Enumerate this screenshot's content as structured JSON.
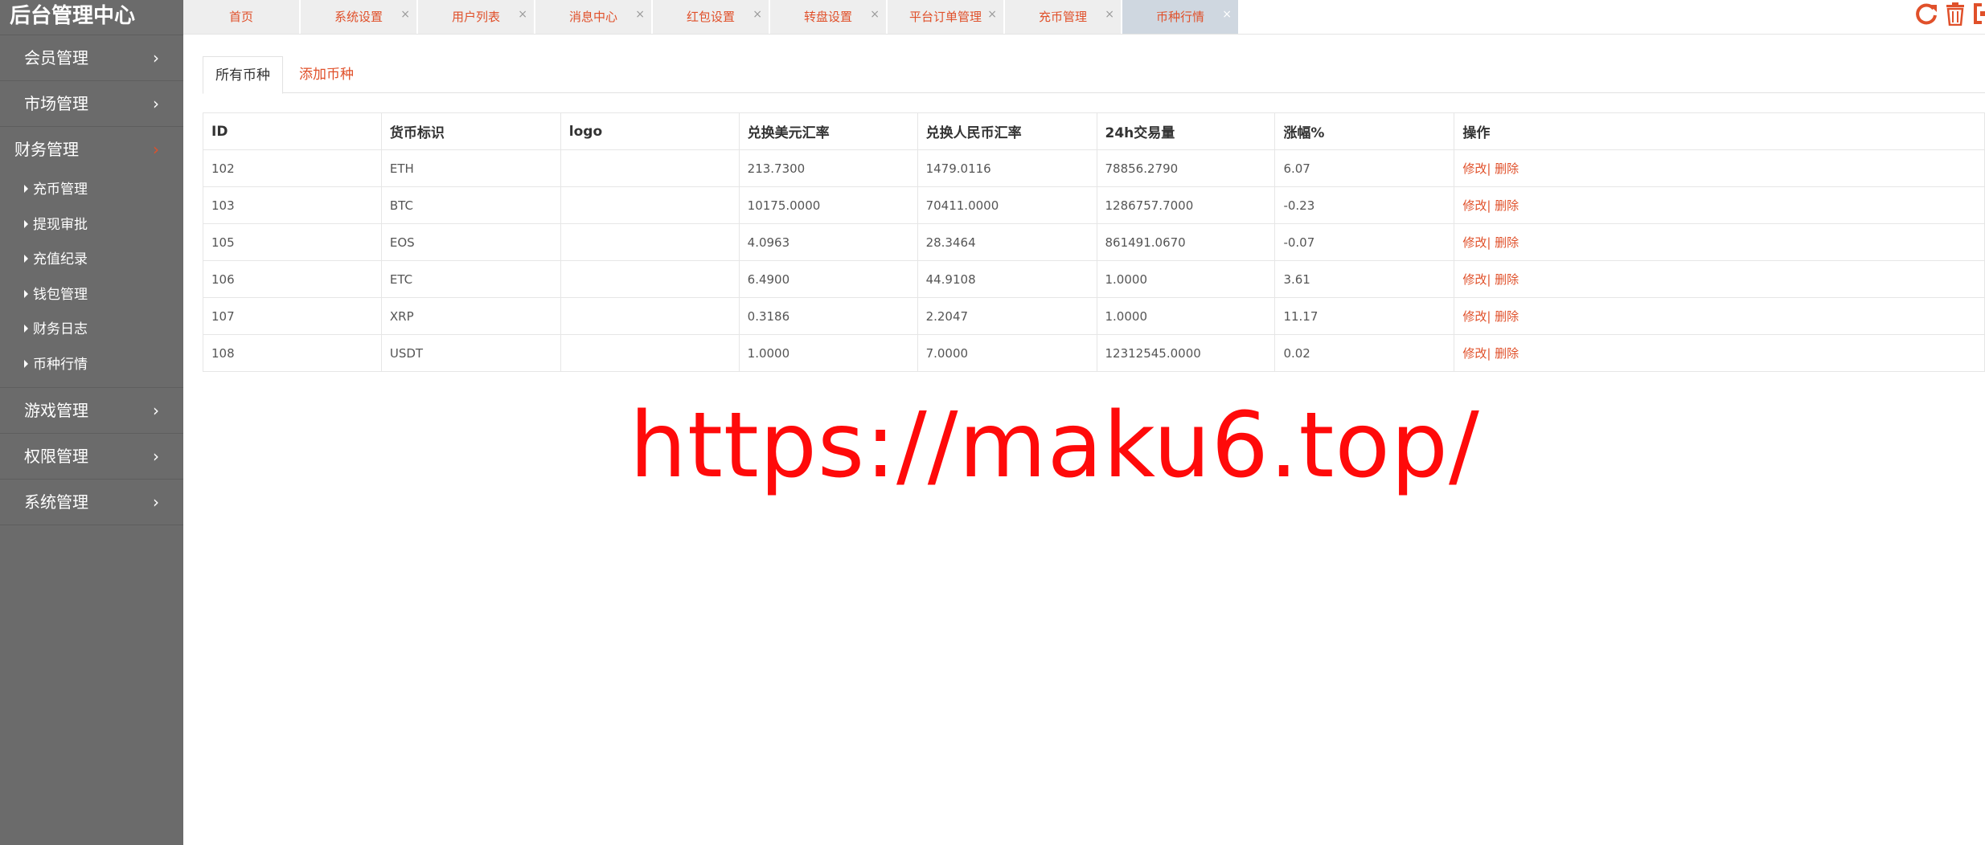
{
  "sidebar": {
    "brand": "后台管理中心",
    "items": [
      {
        "label": "会员管理"
      },
      {
        "label": "市场管理"
      },
      {
        "label": "财务管理"
      },
      {
        "label": "游戏管理"
      },
      {
        "label": "权限管理"
      },
      {
        "label": "系统管理"
      }
    ],
    "finance_sub": [
      {
        "label": "充币管理"
      },
      {
        "label": "提现审批"
      },
      {
        "label": "充值纪录"
      },
      {
        "label": "钱包管理"
      },
      {
        "label": "财务日志"
      },
      {
        "label": "币种行情"
      }
    ],
    "chevron": "›"
  },
  "tabs": [
    {
      "label": "首页"
    },
    {
      "label": "系统设置"
    },
    {
      "label": "用户列表"
    },
    {
      "label": "消息中心"
    },
    {
      "label": "红包设置"
    },
    {
      "label": "转盘设置"
    },
    {
      "label": "平台订单管理"
    },
    {
      "label": "充币管理"
    },
    {
      "label": "币种行情"
    }
  ],
  "tab_close": "×",
  "toolbar_icons": [
    "refresh-icon",
    "trash-icon",
    "exit-icon"
  ],
  "subtabs": {
    "all": "所有币种",
    "add": "添加币种"
  },
  "table": {
    "headers": [
      "ID",
      "货币标识",
      "logo",
      "兑换美元汇率",
      "兑换人民币汇率",
      "24h交易量",
      "涨幅%",
      "操作"
    ],
    "rows": [
      [
        "102",
        "ETH",
        "",
        "213.7300",
        "1479.0116",
        "78856.2790",
        "6.07",
        "修改| 删除"
      ],
      [
        "103",
        "BTC",
        "",
        "10175.0000",
        "70411.0000",
        "1286757.7000",
        "-0.23",
        "修改| 删除"
      ],
      [
        "105",
        "EOS",
        "",
        "4.0963",
        "28.3464",
        "861491.0670",
        "-0.07",
        "修改| 删除"
      ],
      [
        "106",
        "ETC",
        "",
        "6.4900",
        "44.9108",
        "1.0000",
        "3.61",
        "修改| 删除"
      ],
      [
        "107",
        "XRP",
        "",
        "0.3186",
        "2.2047",
        "1.0000",
        "11.17",
        "修改| 删除"
      ],
      [
        "108",
        "USDT",
        "",
        "1.0000",
        "7.0000",
        "12312545.0000",
        "0.02",
        "修改| 删除"
      ]
    ]
  },
  "watermark": "https://maku6.top/",
  "colors": {
    "accent": "#e0502a",
    "sidebar": "#6b6b6b",
    "watermark": "#ff0a0a"
  }
}
